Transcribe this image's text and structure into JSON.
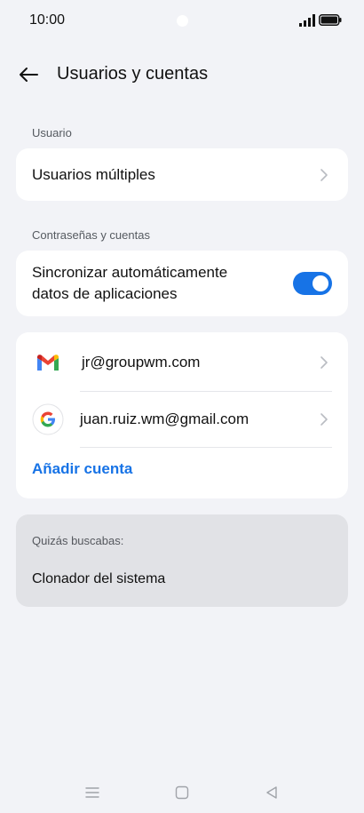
{
  "status_bar": {
    "time": "10:00"
  },
  "header": {
    "title": "Usuarios y cuentas"
  },
  "sections": {
    "user_label": "Usuario",
    "passwords_label": "Contraseñas y cuentas"
  },
  "users": {
    "multiple_users_label": "Usuarios múltiples"
  },
  "sync": {
    "label_line1": "Sincronizar automáticamente",
    "label_line2": "datos de aplicaciones",
    "enabled": true
  },
  "accounts": [
    {
      "email": "jr@groupwm.com",
      "icon": "gmail-icon"
    },
    {
      "email": "juan.ruiz.wm@gmail.com",
      "icon": "google-icon"
    }
  ],
  "add_account_label": "Añadir cuenta",
  "suggestions": {
    "label": "Quizás buscabas:",
    "item": "Clonador del sistema"
  },
  "colors": {
    "accent": "#1773e6",
    "background": "#f2f3f7",
    "card": "#ffffff",
    "suggestion_card": "#e1e2e6"
  }
}
